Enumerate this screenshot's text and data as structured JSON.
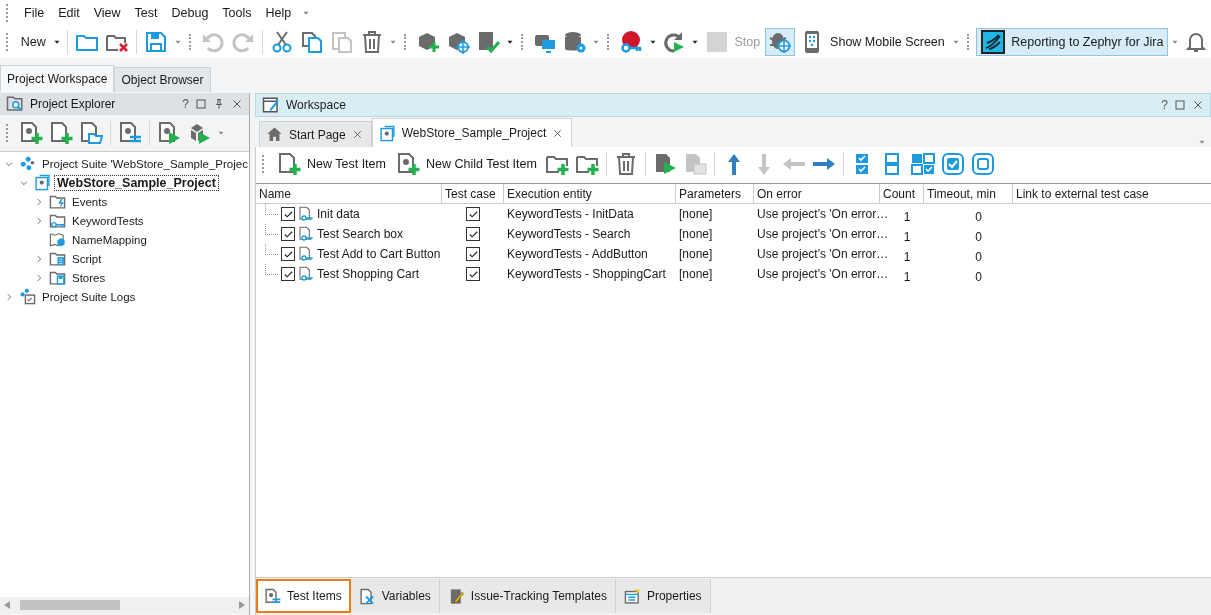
{
  "menu": [
    "File",
    "Edit",
    "View",
    "Test",
    "Debug",
    "Tools",
    "Help"
  ],
  "toolbar": {
    "new_button": {
      "label": "New"
    },
    "stop_button": {
      "label": "Stop",
      "disabled": true
    },
    "debug_toggle": {
      "on": true
    },
    "mobile_button": {
      "label": "Show Mobile Screen"
    },
    "zephyr_button": {
      "label": "Reporting to Zephyr for Jira",
      "on": true
    }
  },
  "left_tabs": [
    {
      "label": "Project Workspace",
      "selected": true
    },
    {
      "label": "Object Browser",
      "selected": false
    }
  ],
  "explorer": {
    "title": "Project Explorer",
    "help": "?",
    "tree": [
      {
        "label": "Project Suite 'WebStore_Sample_Projec",
        "expanded": true,
        "selected": false,
        "children": [
          {
            "label": "WebStore_Sample_Project",
            "expanded": true,
            "selected": true,
            "children": [
              {
                "label": "Events",
                "expanded": false,
                "selected": false
              },
              {
                "label": "KeywordTests",
                "expanded": false,
                "selected": false
              },
              {
                "label": "NameMapping",
                "selected": false
              },
              {
                "label": "Script",
                "expanded": false,
                "selected": false
              },
              {
                "label": "Stores",
                "expanded": false,
                "selected": false
              }
            ]
          }
        ]
      },
      {
        "label": "Project Suite Logs",
        "expanded": false,
        "selected": false
      }
    ]
  },
  "workspace": {
    "title": "Workspace",
    "help": "?",
    "tabs": [
      {
        "label": "Start Page",
        "selected": false
      },
      {
        "label": "WebStore_Sample_Project",
        "selected": true
      }
    ],
    "toolbar": {
      "new_item": "New Test Item",
      "new_child": "New Child Test Item"
    },
    "table": {
      "columns": [
        "Name",
        "Test case",
        "Execution entity",
        "Parameters",
        "On error",
        "Count",
        "Timeout, min",
        "Link to external test case"
      ],
      "rows": [
        {
          "name": "Init data",
          "enabled": true,
          "test_case": true,
          "entity": "KeywordTests - InitData",
          "parameters": "[none]",
          "on_error": "Use project's 'On error…",
          "count": "1",
          "timeout": "0"
        },
        {
          "name": "Test Search box",
          "enabled": true,
          "test_case": true,
          "entity": "KeywordTests - Search",
          "parameters": "[none]",
          "on_error": "Use project's 'On error…",
          "count": "1",
          "timeout": "0"
        },
        {
          "name": "Test Add to Cart Button",
          "enabled": true,
          "test_case": true,
          "entity": "KeywordTests - AddButton",
          "parameters": "[none]",
          "on_error": "Use project's 'On error…",
          "count": "1",
          "timeout": "0"
        },
        {
          "name": "Test Shopping Cart",
          "enabled": true,
          "test_case": true,
          "entity": "KeywordTests - ShoppingCart",
          "parameters": "[none]",
          "on_error": "Use project's 'On error…",
          "count": "1",
          "timeout": "0"
        }
      ]
    },
    "bottom_tabs": [
      {
        "label": "Test Items",
        "selected": true
      },
      {
        "label": "Variables",
        "selected": false
      },
      {
        "label": "Issue-Tracking Templates",
        "selected": false
      },
      {
        "label": "Properties",
        "selected": false
      }
    ]
  }
}
